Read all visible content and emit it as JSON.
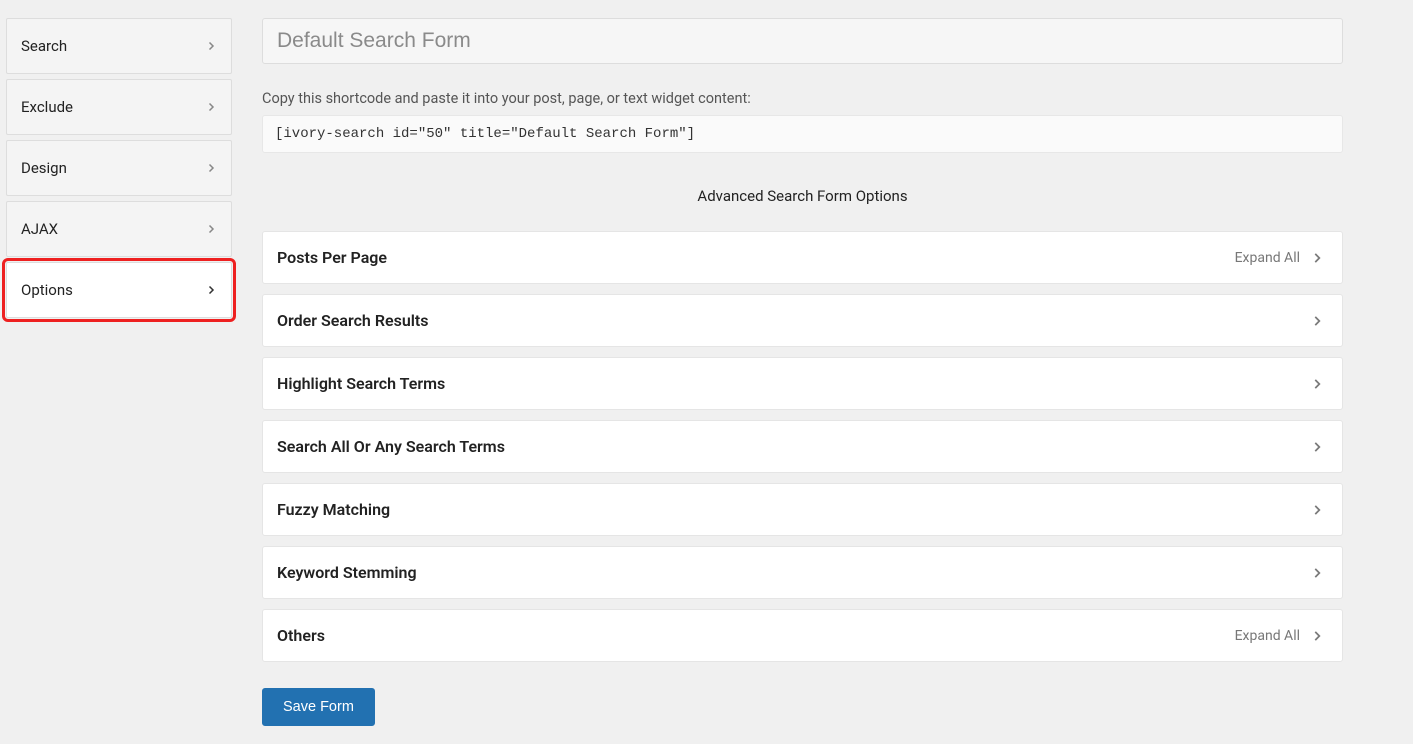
{
  "sidebar": {
    "tabs": [
      {
        "label": "Search",
        "active": false
      },
      {
        "label": "Exclude",
        "active": false
      },
      {
        "label": "Design",
        "active": false
      },
      {
        "label": "AJAX",
        "active": false
      },
      {
        "label": "Options",
        "active": true
      }
    ]
  },
  "header": {
    "form_title": "Default Search Form",
    "shortcode_hint": "Copy this shortcode and paste it into your post, page, or text widget content:",
    "shortcode": "[ivory-search id=\"50\" title=\"Default Search Form\"]"
  },
  "section_heading": "Advanced Search Form Options",
  "panels": [
    {
      "label": "Posts Per Page",
      "expand_all": true
    },
    {
      "label": "Order Search Results",
      "expand_all": false
    },
    {
      "label": "Highlight Search Terms",
      "expand_all": false
    },
    {
      "label": "Search All Or Any Search Terms",
      "expand_all": false
    },
    {
      "label": "Fuzzy Matching",
      "expand_all": false
    },
    {
      "label": "Keyword Stemming",
      "expand_all": false
    },
    {
      "label": "Others",
      "expand_all": true
    }
  ],
  "labels": {
    "expand_all": "Expand All",
    "save_button": "Save Form"
  }
}
